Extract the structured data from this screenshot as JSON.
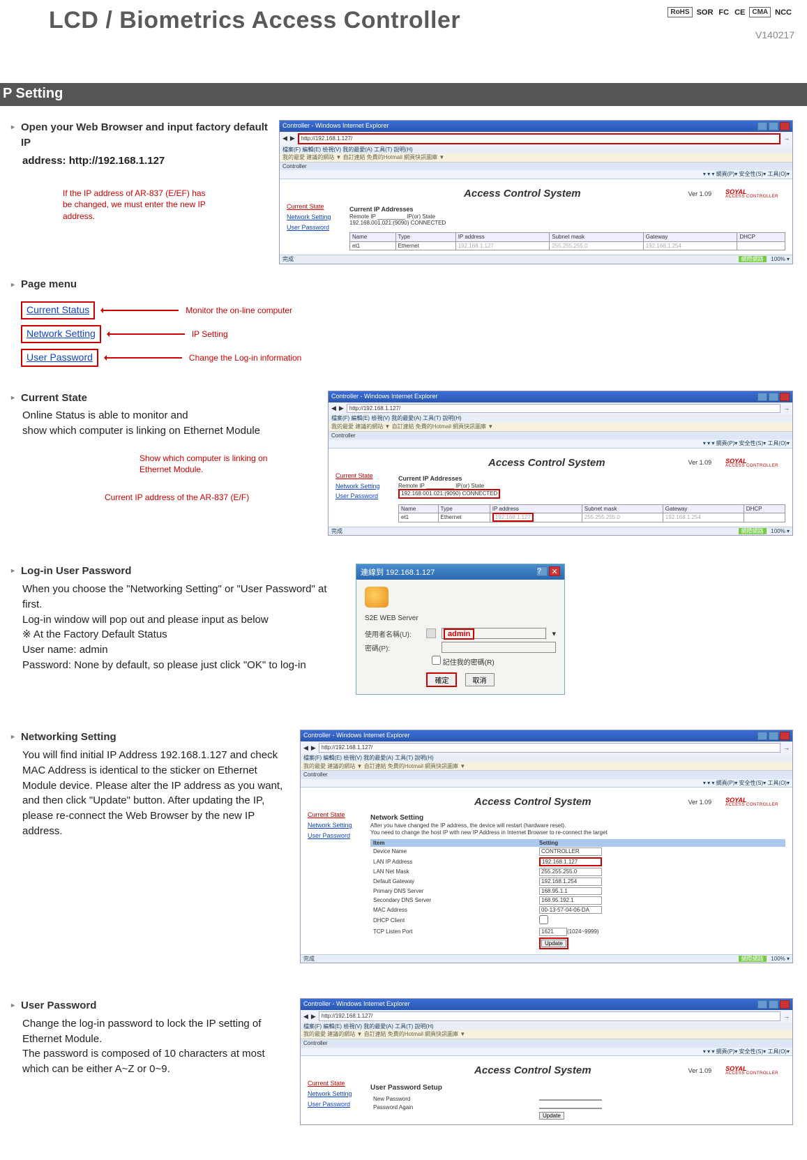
{
  "header": {
    "title": "LCD / Biometrics Access Controller",
    "version": "V140217",
    "logos": [
      "RoHS",
      "SOR",
      "FC",
      "CE",
      "CMA",
      "NCC"
    ]
  },
  "sectionBar": "P Setting",
  "step1": {
    "heading": "Open your Web Browser and input factory default IP",
    "addressLine": "address: http://192.168.1.127",
    "redNote": "If the IP address of AR-837 (E/EF) has be changed, we must enter the new IP address."
  },
  "browser1": {
    "windowTitle": "Controller - Windows Internet Explorer",
    "url": "http://192.168.1.127/",
    "menuItems": "檔案(F)  編輯(E)  檢視(V)  我的最愛(A)  工具(T)  說明(H)",
    "favBar": "我的最愛     建議的網站 ▼  自訂連結  免費的Hotmail  網頁快訊圖庫 ▼",
    "toolStrip": "▾  ▾  ▾  網頁(P)▾ 安全性(S)▾ 工具(O)▾ ",
    "tabLabel": "Controller",
    "sysTitle": "Access Control System",
    "ver": "Ver 1.09",
    "brand": "SOYAL",
    "brandSub": "ACCESS CONTROLLER",
    "sideLinks": {
      "cs": "Current State",
      "ns": "Network Setting",
      "up": "User Password"
    },
    "ipHeader": "Current IP Addresses",
    "remoteLine": "Remote IP _________ IP(or) State",
    "connLine": "192.168.001.021:(9090) CONNECTED",
    "cols": [
      "Name",
      "Type",
      "IP address",
      "Subnet mask",
      "Gateway",
      "DHCP"
    ],
    "row": [
      "et1",
      "Ethernet",
      "192.168.1.127",
      "255.255.255.0",
      "192.168.1.254",
      ""
    ],
    "footerLeft": "完成",
    "footerRight1": "網際網路",
    "footerRight2": "100% ▾"
  },
  "pageMenu": {
    "heading": "Page menu",
    "items": [
      {
        "label": "Current Status",
        "desc": "Monitor the on-line computer"
      },
      {
        "label": "Network Setting",
        "desc": "IP Setting"
      },
      {
        "label": "User Password",
        "desc": "Change the Log-in information"
      }
    ]
  },
  "currentState": {
    "heading": "Current State",
    "line1": "Online Status is able to monitor and",
    "line2": "show which computer is linking on Ethernet Module",
    "red1": "Show which computer is linking on Ethernet Module.",
    "red2": "Current IP address of the AR-837 (E/F)"
  },
  "login": {
    "heading": "Log-in User Password",
    "l1": "When you choose the \"Networking Setting\" or \"User Password\" at first.",
    "l2": "Log-in window will pop out and please input as below",
    "l3": "※ At the Factory Default Status",
    "l4": "User name: admin",
    "l5": "Password: None by default, so please just click \"OK\" to log-in",
    "dialogTitle": "連線到 192.168.1.127",
    "serverLabel": "S2E WEB Server",
    "userLabel": "使用者名稱(U):",
    "passLabel": "密碼(P):",
    "adminValue": "admin",
    "remember": "記住我的密碼(R)",
    "ok": "確定",
    "cancel": "取消"
  },
  "netSetting": {
    "heading": "Networking Setting",
    "body": "You will find initial IP Address 192.168.1.127 and check MAC Address is identical to the sticker on Ethernet Module device.  Please alter the IP address as you want, and then click \"Update\" button.  After updating the IP, please re-connect the Web Browser by the new IP address.",
    "tableTitle": "Network Setting",
    "note1": "After you have changed the IP address, the device will restart (hardware reset).",
    "note2": "You need to change the host IP with new IP Address in Internet Browser to re-connect the target",
    "hdrItem": "Item",
    "hdrSetting": "Setting",
    "rows": [
      {
        "k": "Device Name",
        "v": "CONTROLLER"
      },
      {
        "k": "LAN IP Address",
        "v": "192.168.1.127"
      },
      {
        "k": "LAN Net Mask",
        "v": "255.255.255.0"
      },
      {
        "k": "Default Gateway",
        "v": "192.168.1.254"
      },
      {
        "k": "Primary DNS Server",
        "v": "168.95.1.1"
      },
      {
        "k": "Secondary DNS Server",
        "v": "168.95.192.1"
      },
      {
        "k": "MAC Address",
        "v": "00-13-57-04-06-DA"
      },
      {
        "k": "DHCP Client",
        "v": ""
      },
      {
        "k": "TCP Listen Port",
        "v": "1621 (1024~9999)"
      }
    ],
    "update": "Update"
  },
  "userPass": {
    "heading": "User Password",
    "l1": "Change the log-in password to lock the IP setting of Ethernet Module.",
    "l2": "The password is composed of 10 characters at most which can be either A~Z or 0~9.",
    "sectionTitle": "User Password Setup",
    "f1": "New Password",
    "f2": "Password Again",
    "update": "Update"
  }
}
